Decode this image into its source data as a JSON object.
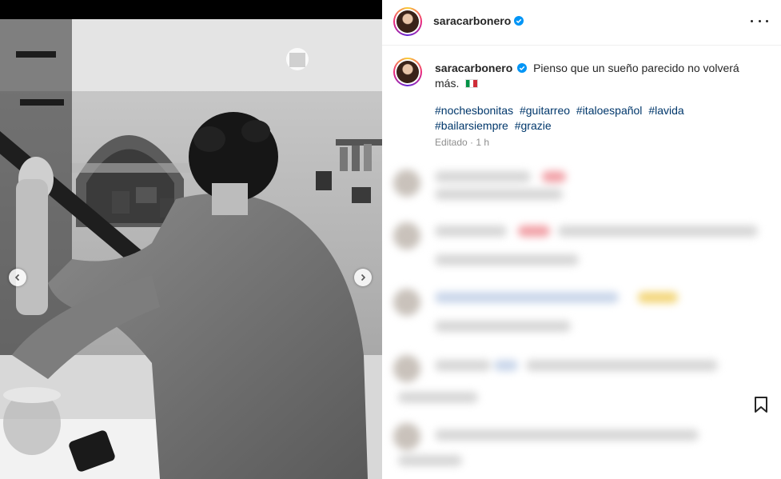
{
  "post": {
    "username": "saracarbonero",
    "verified": true,
    "caption_text": "Pienso que un sueño parecido no volverá más.",
    "flag_emoji": "italy-flag",
    "hashtags": [
      "#nochesbonitas",
      "#guitarreo",
      "#italoespañol",
      "#lavida",
      "#bailarsiempre",
      "#grazie"
    ],
    "edited_label": "Editado",
    "separator": "·",
    "time_ago": "1 h"
  },
  "header": {
    "username": "saracarbonero",
    "more_icon": "more-horizontal-icon"
  },
  "media": {
    "description_icon": "photo",
    "prev_icon": "chevron-left-icon",
    "next_icon": "chevron-right-icon"
  },
  "actions": {
    "bookmark_icon": "bookmark-icon"
  },
  "colors": {
    "link": "#00376b",
    "text": "#262626",
    "muted": "#8e8e8e",
    "verified": "#0095f6"
  }
}
